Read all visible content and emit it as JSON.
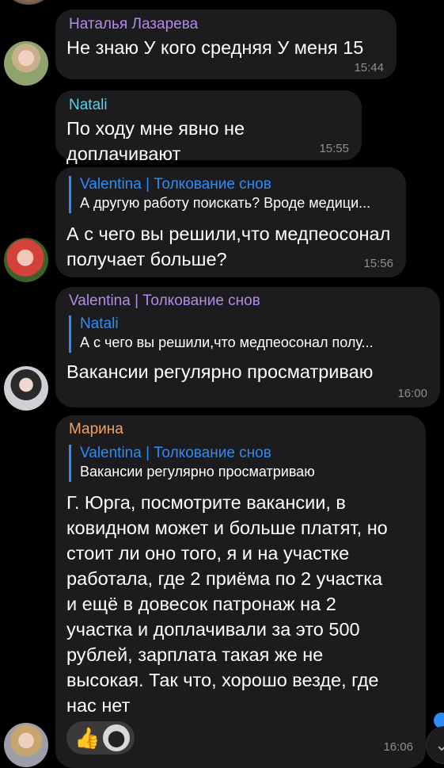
{
  "messages": [
    {
      "sender": "Наталья Лазарева",
      "text": "Не знаю У кого средняя У меня 15",
      "time": "15:44"
    },
    {
      "sender": "Natali",
      "text": "По ходу мне явно не доплачивают",
      "time": "15:55"
    },
    {
      "reply": {
        "name": "Valentina | Толкование снов",
        "text": "А другую работу поискать? Вроде медици..."
      },
      "text": "А с чего вы решили,что медпеосонал\nполучает больше?",
      "time": "15:56"
    },
    {
      "sender": "Valentina | Толкование снов",
      "reply": {
        "name": "Natali",
        "text": "А с чего вы решили,что медпеосонал полу..."
      },
      "text": "Вакансии регулярно просматриваю",
      "time": "16:00"
    },
    {
      "sender": "Марина",
      "reply": {
        "name": "Valentina | Толкование снов",
        "text": "Вакансии регулярно просматриваю"
      },
      "text": "Г. Юрга, посмотрите вакансии, в\nковидном может и больше платят, но\nстоит ли оно того, я и на участке\nработала, где 2 приёма по 2 участка\nи ещё в довесок патронаж на 2\nучастка и доплачивали за это 500\nрублей, зарплата такая же не\nвысокая. Так что, хорошо везде, где\nнас нет",
      "reaction": "👍",
      "time": "16:06"
    }
  ],
  "icons": {
    "scroll_down": "chevron-down-icon"
  },
  "colors": {
    "background": "#000000",
    "bubble": "#1c1c1e",
    "accent": "#2f8bf6"
  }
}
